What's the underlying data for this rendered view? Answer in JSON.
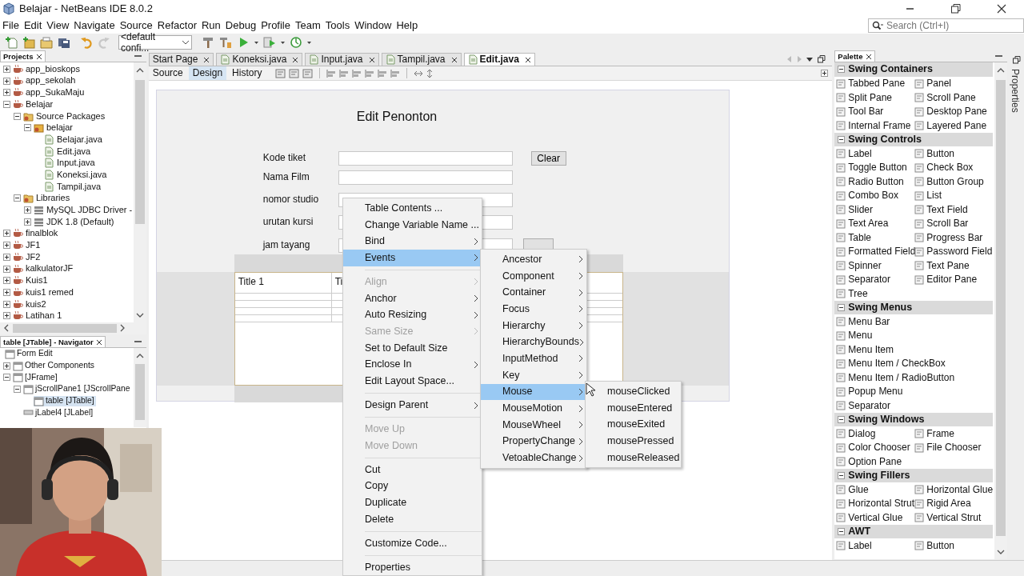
{
  "window": {
    "title": "Belajar - NetBeans IDE 8.0.2"
  },
  "menu_bar": [
    "File",
    "Edit",
    "View",
    "Navigate",
    "Source",
    "Refactor",
    "Run",
    "Debug",
    "Profile",
    "Team",
    "Tools",
    "Window",
    "Help"
  ],
  "search": {
    "placeholder": "Search (Ctrl+I)"
  },
  "toolbar": {
    "configuration": "<default confi..."
  },
  "projects": {
    "title": "Projects",
    "nodes": [
      {
        "label": "app_bioskops",
        "kind": "project",
        "expanded": false
      },
      {
        "label": "app_sekolah",
        "kind": "project",
        "expanded": false
      },
      {
        "label": "app_SukaMaju",
        "kind": "project",
        "expanded": false
      },
      {
        "label": "Belajar",
        "kind": "project",
        "expanded": true,
        "children": [
          {
            "label": "Source Packages",
            "kind": "folder",
            "expanded": true,
            "children": [
              {
                "label": "belajar",
                "kind": "package",
                "expanded": true,
                "children": [
                  {
                    "label": "Belajar.java",
                    "kind": "file"
                  },
                  {
                    "label": "Edit.java",
                    "kind": "file"
                  },
                  {
                    "label": "Input.java",
                    "kind": "file"
                  },
                  {
                    "label": "Koneksi.java",
                    "kind": "file"
                  },
                  {
                    "label": "Tampil.java",
                    "kind": "file"
                  }
                ]
              }
            ]
          },
          {
            "label": "Libraries",
            "kind": "folder",
            "expanded": true,
            "children": [
              {
                "label": "MySQL JDBC Driver -",
                "kind": "library",
                "expanded": false
              },
              {
                "label": "JDK 1.8 (Default)",
                "kind": "library",
                "expanded": false
              }
            ]
          }
        ]
      },
      {
        "label": "finalblok",
        "kind": "project",
        "expanded": false
      },
      {
        "label": "JF1",
        "kind": "project",
        "expanded": false
      },
      {
        "label": "JF2",
        "kind": "project",
        "expanded": false
      },
      {
        "label": "kalkulatorJF",
        "kind": "project",
        "expanded": false
      },
      {
        "label": "Kuis1",
        "kind": "project",
        "expanded": false
      },
      {
        "label": "kuis1 remed",
        "kind": "project",
        "expanded": false
      },
      {
        "label": "kuis2",
        "kind": "project",
        "expanded": false
      },
      {
        "label": "Latihan 1",
        "kind": "project",
        "expanded": false
      }
    ]
  },
  "navigator": {
    "title": "table [JTable] - Navigator",
    "root": "Form Edit",
    "nodes": [
      {
        "label": "Other Components",
        "kind": "component",
        "expanded": false,
        "selected": false
      },
      {
        "label": "[JFrame]",
        "kind": "component",
        "expanded": true,
        "selected": false,
        "children": [
          {
            "label": "jScrollPane1 [JScrollPane",
            "kind": "component",
            "expanded": true,
            "selected": false,
            "children": [
              {
                "label": "table [JTable]",
                "kind": "component",
                "selected": true
              }
            ]
          },
          {
            "label": "jLabel4 [JLabel]",
            "kind": "label",
            "selected": false
          }
        ]
      }
    ]
  },
  "editor": {
    "tabs": [
      {
        "label": "Start Page",
        "selected": false,
        "icon": false
      },
      {
        "label": "Koneksi.java",
        "selected": false,
        "icon": true
      },
      {
        "label": "Input.java",
        "selected": false,
        "icon": true
      },
      {
        "label": "Tampil.java",
        "selected": false,
        "icon": true
      },
      {
        "label": "Edit.java",
        "selected": true,
        "icon": true
      }
    ],
    "views": [
      {
        "label": "Source",
        "selected": false
      },
      {
        "label": "Design",
        "selected": true
      },
      {
        "label": "History",
        "selected": false
      }
    ],
    "form": {
      "title": "Edit Penonton",
      "fields": [
        {
          "label": "Kode tiket"
        },
        {
          "label": "Nama Film"
        },
        {
          "label": "nomor studio"
        },
        {
          "label": "urutan kursi"
        },
        {
          "label": "jam tayang"
        }
      ],
      "clear_button": "Clear",
      "table": {
        "columns": [
          "Title 1",
          "Ti"
        ]
      }
    }
  },
  "context_menu": {
    "items": [
      {
        "kind": "item",
        "label": "Table Contents ...",
        "submenu": false,
        "disabled": false,
        "selected": false
      },
      {
        "kind": "item",
        "label": "Change Variable Name ...",
        "submenu": false,
        "disabled": false,
        "selected": false
      },
      {
        "kind": "item",
        "label": "Bind",
        "submenu": true,
        "disabled": false,
        "selected": false
      },
      {
        "kind": "item",
        "label": "Events",
        "submenu": true,
        "disabled": false,
        "selected": true
      },
      {
        "kind": "separator"
      },
      {
        "kind": "item",
        "label": "Align",
        "submenu": true,
        "disabled": true,
        "selected": false
      },
      {
        "kind": "item",
        "label": "Anchor",
        "submenu": true,
        "disabled": false,
        "selected": false
      },
      {
        "kind": "item",
        "label": "Auto Resizing",
        "submenu": true,
        "disabled": false,
        "selected": false
      },
      {
        "kind": "item",
        "label": "Same Size",
        "submenu": true,
        "disabled": true,
        "selected": false
      },
      {
        "kind": "item",
        "label": "Set to Default Size",
        "submenu": false,
        "disabled": false,
        "selected": false
      },
      {
        "kind": "item",
        "label": "Enclose In",
        "submenu": true,
        "disabled": false,
        "selected": false
      },
      {
        "kind": "item",
        "label": "Edit Layout Space...",
        "submenu": false,
        "disabled": false,
        "selected": false
      },
      {
        "kind": "separator"
      },
      {
        "kind": "item",
        "label": "Design Parent",
        "submenu": true,
        "disabled": false,
        "selected": false
      },
      {
        "kind": "separator"
      },
      {
        "kind": "item",
        "label": "Move Up",
        "submenu": false,
        "disabled": true,
        "selected": false
      },
      {
        "kind": "item",
        "label": "Move Down",
        "submenu": false,
        "disabled": true,
        "selected": false
      },
      {
        "kind": "separator"
      },
      {
        "kind": "item",
        "label": "Cut",
        "submenu": false,
        "disabled": false,
        "selected": false
      },
      {
        "kind": "item",
        "label": "Copy",
        "submenu": false,
        "disabled": false,
        "selected": false
      },
      {
        "kind": "item",
        "label": "Duplicate",
        "submenu": false,
        "disabled": false,
        "selected": false
      },
      {
        "kind": "item",
        "label": "Delete",
        "submenu": false,
        "disabled": false,
        "selected": false
      },
      {
        "kind": "separator"
      },
      {
        "kind": "item",
        "label": "Customize Code...",
        "submenu": false,
        "disabled": false,
        "selected": false
      },
      {
        "kind": "separator"
      },
      {
        "kind": "item",
        "label": "Properties",
        "submenu": false,
        "disabled": false,
        "selected": false
      }
    ]
  },
  "events_submenu": {
    "items": [
      {
        "kind": "item",
        "label": "Ancestor",
        "submenu": true,
        "disabled": false,
        "selected": false
      },
      {
        "kind": "item",
        "label": "Component",
        "submenu": true,
        "disabled": false,
        "selected": false
      },
      {
        "kind": "item",
        "label": "Container",
        "submenu": true,
        "disabled": false,
        "selected": false
      },
      {
        "kind": "item",
        "label": "Focus",
        "submenu": true,
        "disabled": false,
        "selected": false
      },
      {
        "kind": "item",
        "label": "Hierarchy",
        "submenu": true,
        "disabled": false,
        "selected": false
      },
      {
        "kind": "item",
        "label": "HierarchyBounds",
        "submenu": true,
        "disabled": false,
        "selected": false
      },
      {
        "kind": "item",
        "label": "InputMethod",
        "submenu": true,
        "disabled": false,
        "selected": false
      },
      {
        "kind": "item",
        "label": "Key",
        "submenu": true,
        "disabled": false,
        "selected": false
      },
      {
        "kind": "item",
        "label": "Mouse",
        "submenu": true,
        "disabled": false,
        "selected": true
      },
      {
        "kind": "item",
        "label": "MouseMotion",
        "submenu": true,
        "disabled": false,
        "selected": false
      },
      {
        "kind": "item",
        "label": "MouseWheel",
        "submenu": true,
        "disabled": false,
        "selected": false
      },
      {
        "kind": "item",
        "label": "PropertyChange",
        "submenu": true,
        "disabled": false,
        "selected": false
      },
      {
        "kind": "item",
        "label": "VetoableChange",
        "submenu": true,
        "disabled": false,
        "selected": false
      }
    ]
  },
  "mouse_submenu": {
    "items": [
      {
        "kind": "item",
        "label": "mouseClicked",
        "submenu": false,
        "disabled": false,
        "selected": false
      },
      {
        "kind": "item",
        "label": "mouseEntered",
        "submenu": false,
        "disabled": false,
        "selected": false
      },
      {
        "kind": "item",
        "label": "mouseExited",
        "submenu": false,
        "disabled": false,
        "selected": false
      },
      {
        "kind": "item",
        "label": "mousePressed",
        "submenu": false,
        "disabled": false,
        "selected": false
      },
      {
        "kind": "item",
        "label": "mouseReleased",
        "submenu": false,
        "disabled": false,
        "selected": false
      }
    ]
  },
  "palette": {
    "title": "Palette",
    "sections": [
      {
        "title": "Swing Containers",
        "expanded": true,
        "single_column": false,
        "items": [
          "Tabbed Pane",
          "Panel",
          "Split Pane",
          "Scroll Pane",
          "Tool Bar",
          "Desktop Pane",
          "Internal Frame",
          "Layered Pane"
        ]
      },
      {
        "title": "Swing Controls",
        "expanded": true,
        "single_column": false,
        "items": [
          "Label",
          "Button",
          "Toggle Button",
          "Check Box",
          "Radio Button",
          "Button Group",
          "Combo Box",
          "List",
          "Slider",
          "Text Field",
          "Text Area",
          "Scroll Bar",
          "Table",
          "Progress Bar",
          "Formatted Field",
          "Password Field",
          "Spinner",
          "Text Pane",
          "Separator",
          "Editor Pane",
          "Tree"
        ]
      },
      {
        "title": "Swing Menus",
        "expanded": true,
        "single_column": true,
        "items": [
          "Menu Bar",
          "Menu",
          "Menu Item",
          "Menu Item / CheckBox",
          "Menu Item / RadioButton",
          "Popup Menu",
          "Separator"
        ]
      },
      {
        "title": "Swing Windows",
        "expanded": true,
        "single_column": false,
        "items": [
          "Dialog",
          "Frame",
          "Color Chooser",
          "File Chooser",
          "Option Pane"
        ]
      },
      {
        "title": "Swing Fillers",
        "expanded": true,
        "single_column": false,
        "items": [
          "Glue",
          "Horizontal Glue",
          "Horizontal Strut",
          "Rigid Area",
          "Vertical Glue",
          "Vertical Strut"
        ]
      },
      {
        "title": "AWT",
        "expanded": true,
        "single_column": false,
        "items": [
          "Label",
          "Button"
        ]
      }
    ]
  },
  "side_tab": "Properties"
}
